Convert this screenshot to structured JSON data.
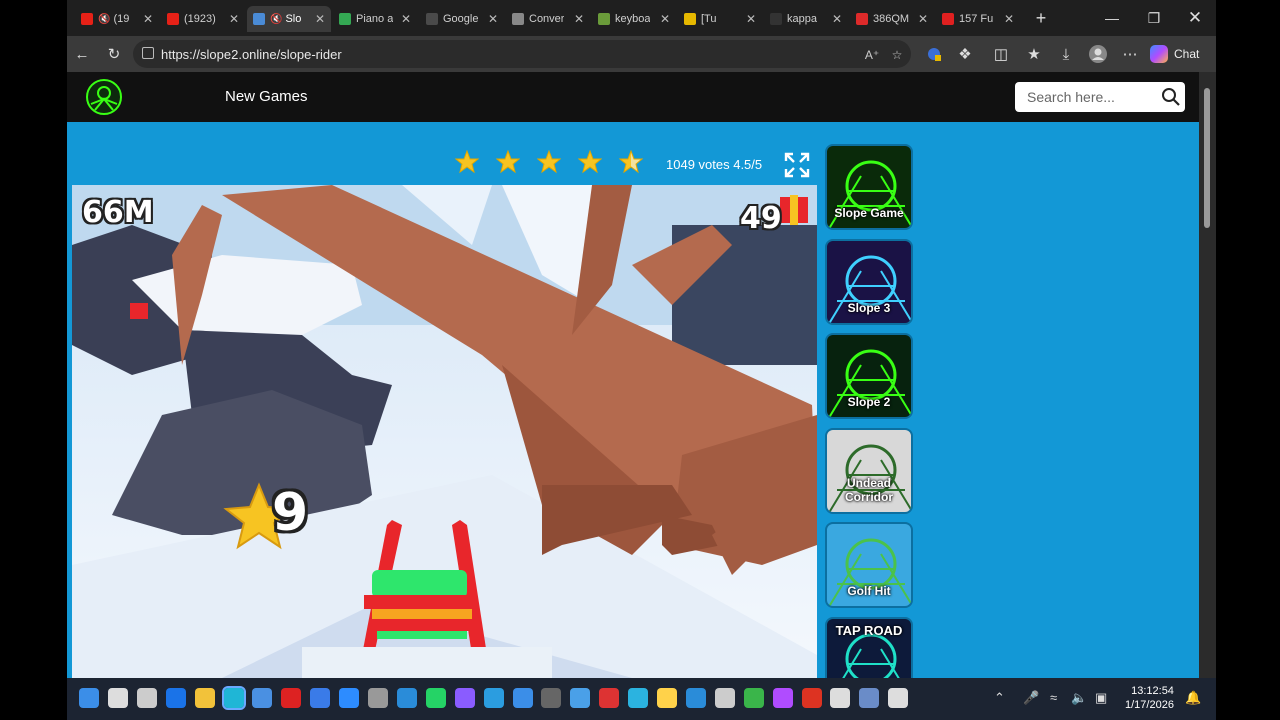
{
  "browser": {
    "tabs": [
      {
        "title": "(19",
        "favicon": "youtube-icon",
        "fav_color": "#e62117",
        "muted": true
      },
      {
        "title": "(1923)",
        "favicon": "youtube-icon",
        "fav_color": "#e62117"
      },
      {
        "title": "Slo",
        "favicon": "game-icon",
        "fav_color": "#4a8bd6",
        "muted": true,
        "active": true
      },
      {
        "title": "Piano a",
        "favicon": "pinwheel-icon",
        "fav_color": "#34a853"
      },
      {
        "title": "Google",
        "favicon": "maps-pin-icon",
        "fav_color": "#4a4a4a"
      },
      {
        "title": "Conver",
        "favicon": "page-icon",
        "fav_color": "#888888"
      },
      {
        "title": "keyboa",
        "favicon": "asterisk-icon",
        "fav_color": "#6a9b3a"
      },
      {
        "title": "[Tu",
        "favicon": "pencil-icon",
        "fav_color": "#e6b800"
      },
      {
        "title": "kappa",
        "favicon": "blank-icon",
        "fav_color": "#333333"
      },
      {
        "title": "386QM",
        "favicon": "flag-icon",
        "fav_color": "#dd2a2a"
      },
      {
        "title": "157 Fu",
        "favicon": "bl-icon",
        "fav_color": "#e02020"
      }
    ],
    "address": "https://slope2.online/slope-rider",
    "chat_label": "Chat"
  },
  "site": {
    "nav_new_games": "New Games",
    "search_placeholder": "Search here..."
  },
  "rating": {
    "stars": 4.5,
    "votes_text": "1049 votes 4.5/5"
  },
  "game": {
    "distance": "66M",
    "gifts": "49",
    "combo": "9"
  },
  "sidebar": {
    "games": [
      {
        "label": "Slope Game",
        "theme": "#0a2a0a",
        "accent": "#39ff14"
      },
      {
        "label": "Slope 3",
        "theme": "#1a1245",
        "accent": "#3fd0ff"
      },
      {
        "label": "Slope 2",
        "theme": "#07220e",
        "accent": "#39ff14"
      },
      {
        "label": "Undead Corridor",
        "theme": "#d8d8d8",
        "accent": "#2d6b2a"
      },
      {
        "label": "Golf Hit",
        "theme": "#3aa8e0",
        "accent": "#4bc24b"
      },
      {
        "label": "TAP ROAD",
        "theme": "#0d1a3a",
        "accent": "#1fe0c8"
      }
    ]
  },
  "taskbar": {
    "time": "13:12:54",
    "date": "1/17/2026"
  },
  "colors": {
    "site_bg": "#1398d6",
    "header_bg": "#111111",
    "star": "#f7c422"
  }
}
